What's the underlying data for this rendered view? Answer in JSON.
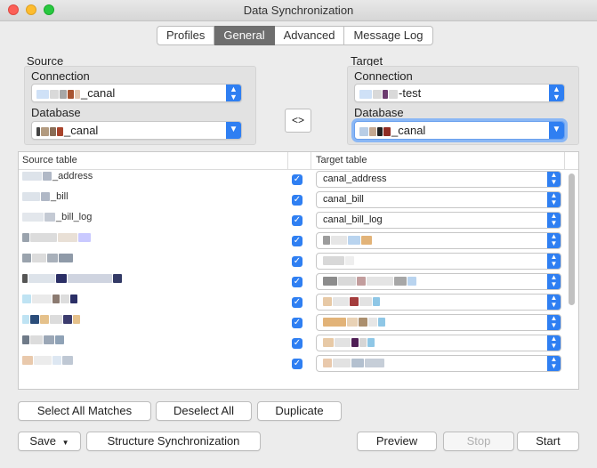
{
  "window": {
    "title": "Data Synchronization"
  },
  "tabs": [
    {
      "label": "Profiles",
      "active": false
    },
    {
      "label": "General",
      "active": true
    },
    {
      "label": "Advanced",
      "active": false
    },
    {
      "label": "Message Log",
      "active": false
    }
  ],
  "source": {
    "section_label": "Source",
    "connection_label": "Connection",
    "connection_value": "_canal",
    "database_label": "Database",
    "database_value": "_canal"
  },
  "target": {
    "section_label": "Target",
    "connection_label": "Connection",
    "connection_value": "-test",
    "database_label": "Database",
    "database_value": "_canal"
  },
  "swap_button": {
    "label": "<>"
  },
  "table": {
    "source_header": "Source table",
    "target_header": "Target table",
    "rows": [
      {
        "source": "_address",
        "checked": true,
        "target": "canal_address"
      },
      {
        "source": "_bill",
        "checked": true,
        "target": "canal_bill"
      },
      {
        "source": "_bill_log",
        "checked": true,
        "target": "canal_bill_log"
      },
      {
        "source": "",
        "checked": true,
        "target": ""
      },
      {
        "source": "",
        "checked": true,
        "target": ""
      },
      {
        "source": "",
        "checked": true,
        "target": ""
      },
      {
        "source": "",
        "checked": true,
        "target": ""
      },
      {
        "source": "",
        "checked": true,
        "target": ""
      },
      {
        "source": "",
        "checked": true,
        "target": ""
      },
      {
        "source": "",
        "checked": true,
        "target": ""
      }
    ]
  },
  "buttons": {
    "select_all_matches": "Select All Matches",
    "deselect_all": "Deselect All",
    "duplicate": "Duplicate",
    "save": "Save",
    "structure_sync": "Structure Synchronization",
    "preview": "Preview",
    "stop": "Stop",
    "start": "Start"
  },
  "colors": {
    "accent": "#2f7ff2",
    "active_tab": "#6e6e6e"
  },
  "icons": {
    "checkbox": "checkmark-icon",
    "select_arrow": "updown-chevron-icon",
    "save_menu": "chevron-down-icon"
  }
}
